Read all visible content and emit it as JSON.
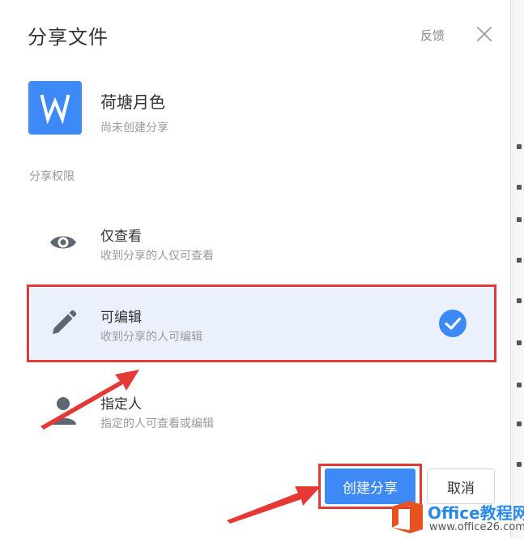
{
  "dialog": {
    "title": "分享文件",
    "feedback_label": "反馈",
    "file": {
      "name": "荷塘月色",
      "status": "尚未创建分享",
      "icon_letter": "W"
    },
    "permission_label": "分享权限",
    "options": [
      {
        "title": "仅查看",
        "desc": "收到分享的人仅可查看",
        "icon": "eye-icon",
        "selected": false
      },
      {
        "title": "可编辑",
        "desc": "收到分享的人可编辑",
        "icon": "pencil-icon",
        "selected": true
      },
      {
        "title": "指定人",
        "desc": "指定的人可查看或编辑",
        "icon": "person-icon",
        "selected": false
      }
    ],
    "create_button": "创建分享",
    "cancel_button": "取消"
  },
  "watermark": {
    "brand": "Office教程网",
    "url": "www.office26.com"
  },
  "colors": {
    "accent": "#3d8af7",
    "highlight": "#e53935",
    "selected_bg": "#eaf1fd"
  }
}
